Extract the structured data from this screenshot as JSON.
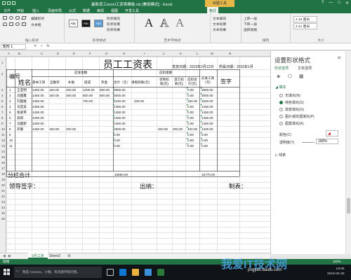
{
  "window": {
    "title": "最新员工excel工资表模板.xls [兼容模式] - Excel",
    "context_tab_group": "绘图工具",
    "controls": [
      "?",
      "—",
      "□",
      "✕"
    ]
  },
  "ribbon_tabs": [
    "文件",
    "开始",
    "插入",
    "页面布局",
    "公式",
    "数据",
    "审阅",
    "视图",
    "开发工具",
    "格式"
  ],
  "ribbon": {
    "insert_shapes_label": "插入形状",
    "edit_shape": "编辑形状",
    "text_box": "文本框",
    "shape_styles_label": "形状样式",
    "style_thumbs": [
      "Abc",
      "Abc",
      "Abc"
    ],
    "shape_fill": "形状填充",
    "shape_outline": "形状轮廓",
    "shape_effects": "形状效果",
    "wordart_label": "艺术字样式",
    "wordart_letters": [
      "A",
      "A",
      "A"
    ],
    "text_fill": "文本填充",
    "text_outline": "文本轮廓",
    "text_effects": "文本效果",
    "arrange": [
      "上移一层",
      "下移一层",
      "选择窗格"
    ],
    "arrange_label": "排列",
    "height_value": "4.18 厘米",
    "width_value": "2.41 厘米",
    "size_label": "大小"
  },
  "formula_bar": {
    "name_box": "矩形 1",
    "icons": [
      "✕",
      "✓",
      "fx"
    ]
  },
  "column_headers": [
    "A",
    "B",
    "C",
    "D",
    "E",
    "F",
    "G",
    "H",
    "I",
    "J",
    "K",
    "L",
    "M",
    "N"
  ],
  "row_headers": [
    "1",
    "2",
    "3",
    "4",
    "5",
    "6",
    "7",
    "8",
    "9",
    "10",
    "11",
    "12",
    "13",
    "14",
    "15",
    "16",
    "17",
    "18",
    "19",
    "20",
    "21",
    "22",
    "23",
    "24",
    "25",
    "26"
  ],
  "sheet": {
    "title": "员工工资表",
    "issue_date": "发放日期：2015年2月12日",
    "period": "所属日期：2015年1月",
    "h_no": "编号",
    "h_name": "姓名",
    "h_payable": "应发金额",
    "h_deduct": "应扣金额",
    "h_net": "实发工资（元）",
    "h_sign": "签字",
    "sub_headers": [
      "基本工资",
      "全勤奖",
      "补助",
      "提成",
      "奖金",
      "合计（元）",
      "请假扣款(元)",
      "迟到扣款(元)",
      "其它扣款(元)",
      "应扣合计(元)"
    ],
    "rows": [
      {
        "no": "1",
        "name": "王亚明",
        "base": "1450.00",
        "attend": "150.00",
        "subsidy": "200.00",
        "commission": "1200.00",
        "bonus": "900.00",
        "total": "3900.00",
        "leave": "",
        "late": "",
        "other": "",
        "ded_total": "0.00",
        "net": "3900.00"
      },
      {
        "no": "2",
        "name": "马国鑫",
        "base": "1450.00",
        "attend": "150.00",
        "subsidy": "200.00",
        "commission": "800.00",
        "bonus": "800.00",
        "total": "3000.00",
        "leave": "",
        "late": "",
        "other": "",
        "ded_total": "0.00",
        "net": "3000.00"
      },
      {
        "no": "3",
        "name": "刘国维",
        "base": "1450.00",
        "attend": "",
        "subsidy": "",
        "commission": "700.00",
        "bonus": "",
        "total": "2150.00",
        "leave": "330.00",
        "late": "",
        "other": "",
        "ded_total": "330.00",
        "net": "1820.00"
      },
      {
        "no": "4",
        "name": "马亚美",
        "base": "1450.00",
        "attend": "",
        "subsidy": "",
        "commission": "",
        "bonus": "",
        "total": "1450.00",
        "leave": "",
        "late": "",
        "other": "",
        "ded_total": "0.00",
        "net": "1450.00"
      },
      {
        "no": "5",
        "name": "张爱琴",
        "base": "1450.00",
        "attend": "",
        "subsidy": "",
        "commission": "",
        "bonus": "",
        "total": "1450.00",
        "leave": "",
        "late": "",
        "other": "",
        "ded_total": "0.00",
        "net": "1450.00"
      },
      {
        "no": "6",
        "name": "高阳",
        "base": "1450.00",
        "attend": "",
        "subsidy": "",
        "commission": "",
        "bonus": "",
        "total": "1450.00",
        "leave": "",
        "late": "",
        "other": "",
        "ded_total": "0.00",
        "net": "1450.00"
      },
      {
        "no": "7",
        "name": "马国新",
        "base": "1450.00",
        "attend": "",
        "subsidy": "",
        "commission": "",
        "bonus": "",
        "total": "1450.00",
        "leave": "",
        "late": "",
        "other": "",
        "ded_total": "0.00",
        "net": "1450.00"
      },
      {
        "no": "8",
        "name": "邓睿",
        "base": "1450.00",
        "attend": "150.00",
        "subsidy": "200.00",
        "commission": "",
        "bonus": "",
        "total": "1800.00",
        "leave": "",
        "late": "200.00",
        "other": "200.00",
        "ded_total": "400.00",
        "net": "1400.00"
      },
      {
        "no": "9",
        "name": "",
        "base": "",
        "attend": "",
        "subsidy": "",
        "commission": "",
        "bonus": "",
        "total": "0.00",
        "leave": "",
        "late": "",
        "other": "",
        "ded_total": "0.00",
        "net": "0.00"
      },
      {
        "no": "10",
        "name": "",
        "base": "",
        "attend": "",
        "subsidy": "",
        "commission": "",
        "bonus": "",
        "total": "0.00",
        "leave": "",
        "late": "",
        "other": "",
        "ded_total": "0.00",
        "net": "0.00"
      },
      {
        "no": "11",
        "name": "",
        "base": "",
        "attend": "",
        "subsidy": "",
        "commission": "",
        "bonus": "",
        "total": "0.00",
        "leave": "",
        "late": "",
        "other": "",
        "ded_total": "0.00",
        "net": "0.00"
      }
    ],
    "subtotal_label": "分栏合计",
    "subtotal_total": "16650.00",
    "subtotal_net": "15770.00",
    "footer_leader": "领导签字：",
    "footer_cashier": "出纳：",
    "footer_preparer": "制表："
  },
  "format_pane": {
    "title": "设置形状格式",
    "close": "✕",
    "tab_shape": "形状选项",
    "tab_text": "文本选项",
    "section_fill": "◢ 填充",
    "options": [
      "无填充(N)",
      "纯色填充(S)",
      "渐变填充(G)",
      "图片或纹理填充(P)",
      "图案填充(A)"
    ],
    "selected_option": "纯色填充(S)",
    "color_label": "颜色(C)",
    "transparency_label": "透明度(T)",
    "transparency_value": "100%",
    "section_line": "▷ 线条"
  },
  "sheet_tabs": [
    "5月工资",
    "Sheet3"
  ],
  "status": {
    "left": "就绪",
    "zoom": "100%"
  },
  "taskbar": {
    "search_placeholder": "我是 Cortana，小娜。有问题尽管问我。",
    "time": "19:05",
    "date": "2016-03-25",
    "watermark": "我爱IT技术网",
    "watermark_url": "jingyan.baidu.com"
  },
  "colors": {
    "excel_green": "#217346",
    "context_tab": "#e6b84a",
    "error_triangle": "#1f8d2e"
  }
}
